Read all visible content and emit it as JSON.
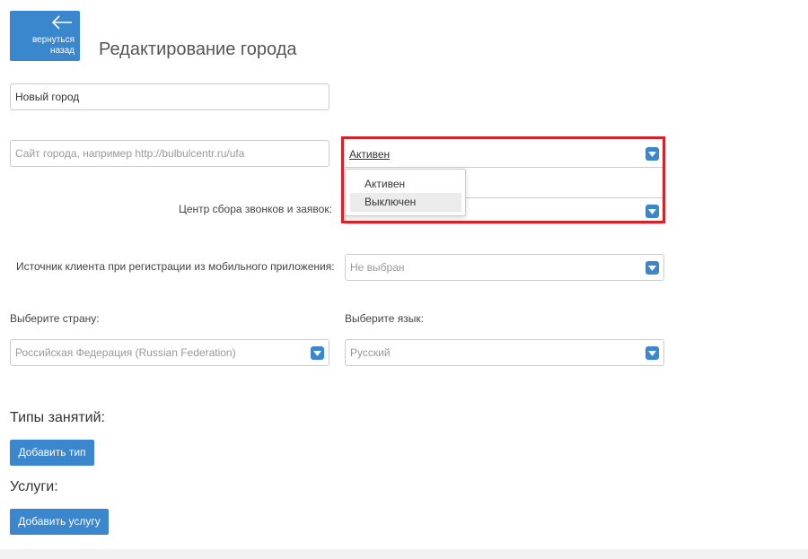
{
  "header": {
    "back_label_line1": "вернуться",
    "back_label_line2": "назад",
    "title": "Редактирование города"
  },
  "form": {
    "city_name": {
      "value": "Новый город"
    },
    "city_site": {
      "placeholder": "Сайт города, например http://bulbulcentr.ru/ufa"
    },
    "status": {
      "selected": "Активен",
      "options": [
        "Активен",
        "Выключен"
      ],
      "highlighted_option": "Выключен"
    },
    "call_center": {
      "label": "Центр сбора звонков и заявок:"
    },
    "client_source": {
      "label": "Источник клиента при регистрации из мобильного приложения:",
      "value": "Не выбран"
    },
    "country": {
      "label": "Выберите страну:",
      "value": "Российская Федерация (Russian Federation)"
    },
    "language": {
      "label": "Выберите язык:",
      "value": "Русский"
    }
  },
  "sections": {
    "activity_types": {
      "title": "Типы занятий:",
      "button": "Добавить тип"
    },
    "services": {
      "title": "Услуги:",
      "button": "Добавить услугу"
    }
  },
  "colors": {
    "accent": "#3a87cd",
    "highlight_border": "#d2232a"
  },
  "icons": {
    "back": "arrow-left-icon",
    "dropdown": "chevron-down-icon"
  }
}
